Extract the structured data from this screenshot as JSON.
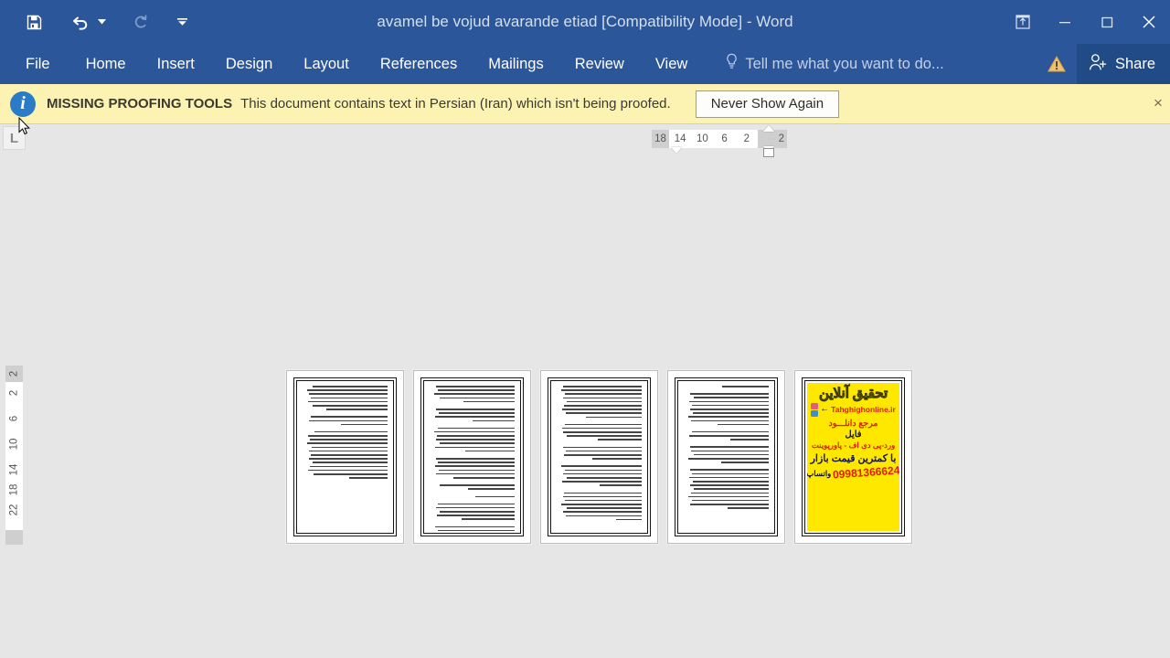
{
  "window": {
    "title": "avamel be vojud avarande etiad [Compatibility Mode] - Word",
    "quick_access": [
      {
        "name": "save",
        "icon": "save-icon",
        "label": "Save",
        "disabled": false
      },
      {
        "name": "undo",
        "icon": "undo-icon",
        "label": "Undo",
        "disabled": false
      },
      {
        "name": "redo",
        "icon": "redo-icon",
        "label": "Redo",
        "disabled": true
      },
      {
        "name": "customize",
        "icon": "chevron-down-icon",
        "label": "Customize Quick Access Toolbar",
        "disabled": false
      }
    ],
    "controls": [
      {
        "name": "ribbon-display-options",
        "icon": "ribbon-options-icon",
        "label": "Ribbon Display Options"
      },
      {
        "name": "minimize",
        "icon": "minimize-icon",
        "label": "Minimize"
      },
      {
        "name": "restore",
        "icon": "restore-icon",
        "label": "Restore Down"
      },
      {
        "name": "close",
        "icon": "close-icon",
        "label": "Close"
      }
    ]
  },
  "ribbon": {
    "tabs": [
      {
        "label": "File"
      },
      {
        "label": "Home"
      },
      {
        "label": "Insert"
      },
      {
        "label": "Design"
      },
      {
        "label": "Layout"
      },
      {
        "label": "References"
      },
      {
        "label": "Mailings"
      },
      {
        "label": "Review"
      },
      {
        "label": "View"
      }
    ],
    "tell_me": "Tell me what you want to do...",
    "warning_label": "!",
    "share_label": "Share"
  },
  "notification": {
    "icon": "info-icon",
    "title": "MISSING PROOFING TOOLS",
    "message": "This document contains text in Persian (Iran) which isn't being proofed.",
    "button_label": "Never Show Again",
    "close_label": "×",
    "background": "#fcf3b2"
  },
  "rulers": {
    "tab_selector_glyph": "L",
    "horizontal_numbers": [
      "18",
      "14",
      "10",
      "6",
      "2",
      "2"
    ],
    "vertical_numbers": [
      "2",
      "2",
      "6",
      "10",
      "14",
      "18",
      "22"
    ]
  },
  "document": {
    "page_count": 5,
    "pages": [
      {
        "label": "page-1",
        "type": "text",
        "paragraphs": [
          [
            88,
            95,
            92,
            90,
            94,
            88,
            72
          ],
          [
            90,
            93,
            55
          ],
          [
            86,
            94,
            91,
            95,
            89,
            92,
            90,
            93,
            88,
            91,
            94,
            87,
            45
          ]
        ]
      },
      {
        "label": "page-2",
        "type": "text",
        "paragraphs": [
          [
            93,
            90,
            95,
            88,
            60
          ],
          [
            92,
            89,
            94,
            50
          ],
          [
            90,
            95,
            91,
            93,
            88,
            94,
            58
          ],
          [
            92,
            90,
            94,
            89,
            93,
            72
          ],
          [
            88,
            55
          ],
          [
            46
          ],
          [
            90,
            93,
            88,
            91,
            62
          ],
          [
            94,
            90,
            92,
            89,
            95,
            91,
            34
          ]
        ]
      },
      {
        "label": "page-3",
        "type": "text",
        "paragraphs": [
          [
            92,
            95,
            90,
            93,
            88,
            91,
            94,
            89,
            66
          ],
          [
            90,
            94,
            92,
            88,
            52
          ],
          [
            93,
            89,
            91,
            58
          ],
          [
            95,
            90,
            92,
            88,
            94,
            49
          ],
          [
            91,
            93,
            90,
            95,
            88,
            92,
            89,
            30
          ]
        ]
      },
      {
        "label": "page-4",
        "type": "text",
        "paragraphs": [
          [
            55
          ],
          [
            92,
            88,
            94,
            90,
            93,
            89,
            95,
            91,
            60
          ],
          [
            90,
            94,
            45
          ],
          [
            93,
            91,
            88,
            95,
            56
          ],
          [
            92,
            90,
            94,
            89,
            93,
            88,
            91,
            95,
            90,
            92,
            48
          ]
        ]
      },
      {
        "label": "page-5",
        "type": "advertisement",
        "ad": {
          "background": "#ffe800",
          "title": "تحقیق آنلاین",
          "url": "Tahghighonline.ir",
          "arrow": "←",
          "line1": "مرجع دانلـــود",
          "line2": "فایل",
          "line3": "ورد-پی دی اف - پاورپوینت",
          "line4": "با کمترین قیمت بازار",
          "phone": "09981366624",
          "phone_label": "واتساپ"
        }
      }
    ]
  },
  "theme": {
    "chrome_blue": "#2b579a",
    "share_blue": "#204b87",
    "canvas_gray": "#e6e6e6",
    "notice_yellow": "#fcf3b2",
    "ad_yellow": "#ffe800",
    "ad_red": "#e01b00",
    "ad_navy": "#14143c"
  }
}
